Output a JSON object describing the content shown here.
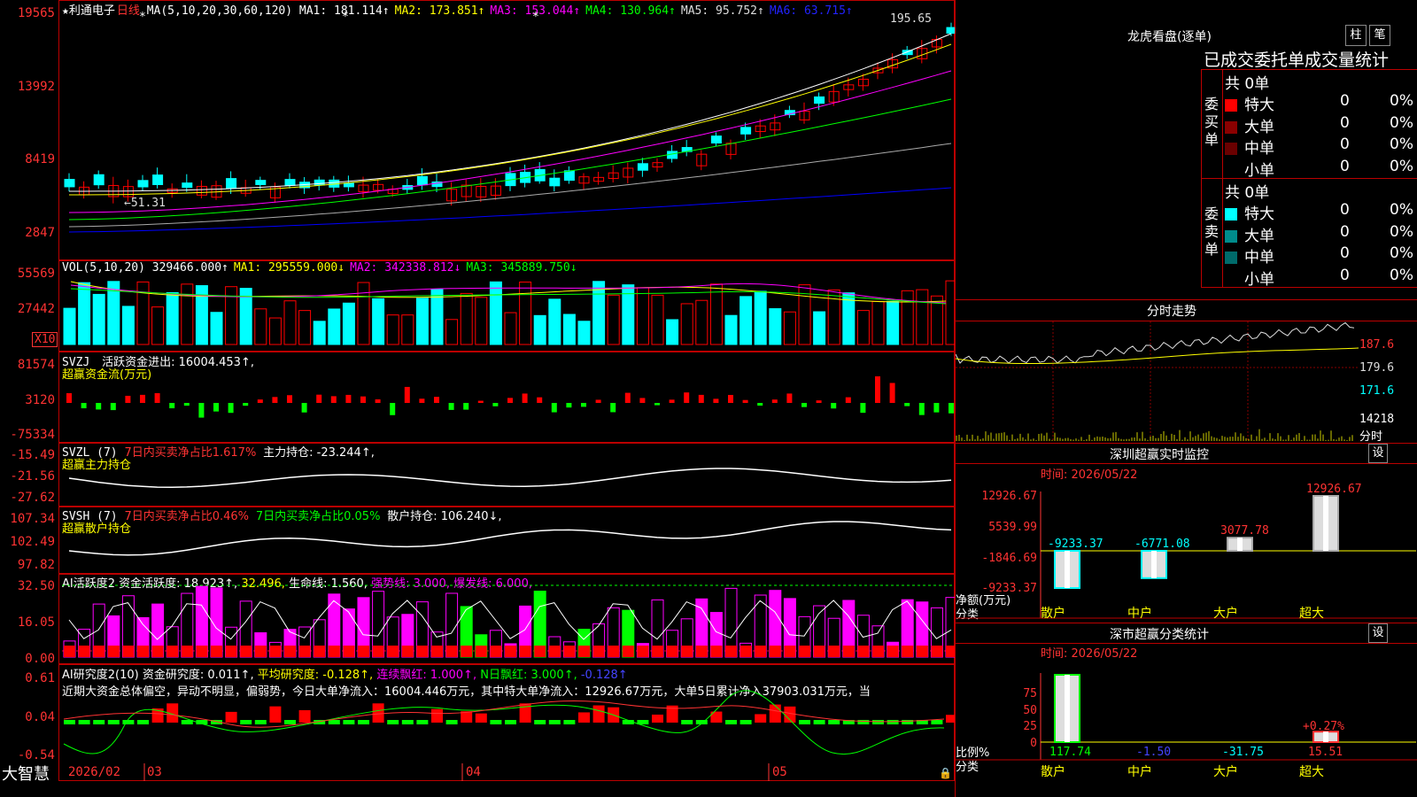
{
  "stock": {
    "star": "★",
    "name": "利通电子",
    "period": "日线",
    "ma_params": "MA(5,10,20,30,60,120)"
  },
  "main": {
    "ma_labels": [
      "MA1: 181.114↑",
      "MA2: 173.851↑",
      "MA3: 153.044↑",
      "MA4: 130.964↑",
      "MA5: 95.752↑",
      "MA6: 63.715↑"
    ],
    "y_ticks": [
      "19565",
      "13992",
      "8419",
      "2847"
    ],
    "high_label": "195.65",
    "low_label": "←51.31",
    "star_marks": [
      "*",
      "*",
      "*"
    ]
  },
  "vol": {
    "title": "VOL(5,10,20)",
    "value": "329466.000↑",
    "ma1": "MA1: 295559.000↓",
    "ma2": "MA2: 342338.812↓",
    "ma3": "MA3: 345889.750↓",
    "y_ticks": [
      "55569",
      "27442"
    ],
    "unit": "X10"
  },
  "svzj": {
    "title": "SVZJ",
    "label": "活跃资金进出: 16004.453↑,",
    "sub": "超赢资金流(万元)",
    "y_ticks": [
      "81574",
      "3120",
      "-75334"
    ]
  },
  "svzl": {
    "title": "SVZL (7)",
    "pct": "7日内买卖净占比1.617%",
    "label": "主力持仓: -23.244↑,",
    "sub": "超赢主力持仓",
    "y_ticks": [
      "-15.49",
      "-21.56",
      "-27.62"
    ]
  },
  "svsh": {
    "title": "SVSH (7)",
    "pct1": "7日内买卖净占比0.46%",
    "pct2": "7日内买卖净占比0.05%",
    "label": "散户持仓: 106.240↓,",
    "sub": "超赢散户持仓",
    "y_ticks": [
      "107.34",
      "102.49",
      "97.82"
    ]
  },
  "ai1": {
    "title": "AI活跃度2",
    "label": "资金活跃度: 18.923↑,",
    "v2": "32.496,",
    "life": "生命线: 1.560,",
    "strong": "强势线: 3.000,",
    "burst": "爆发线: 6.000,",
    "y_ticks": [
      "32.50",
      "16.05",
      "0.00"
    ]
  },
  "ai2": {
    "title": "AI研究度2(10)",
    "label": "资金研究度: 0.011↑,",
    "avg": "平均研究度: -0.128↑,",
    "red": "连续飘红: 1.000↑,",
    "nred": "N日飘红: 3.000↑,",
    "neg": "-0.128↑",
    "comment": "近期大资金总体偏空，异动不明显，偏弱势，今日大单净流入：16004.446万元，其中特大单净流入：12926.67万元，大单5日累计净入37903.031万元，当",
    "y_ticks": [
      "0.61",
      "0.04",
      "-0.54"
    ]
  },
  "bottom": {
    "brand": "大智慧",
    "dates": [
      "2026/02",
      "03",
      "04",
      "05"
    ]
  },
  "lhb": {
    "title": "龙虎看盘(逐单)",
    "btn1": "柱",
    "btn2": "笔",
    "header": "已成交委托单成交量统计",
    "buy_side": "委买单",
    "sell_side": "委卖单",
    "buy_total": "共 0单",
    "sell_total": "共 0单",
    "buy_rows": [
      {
        "label": "特大",
        "qty": "0",
        "pct": "0%",
        "color": "#ff0000"
      },
      {
        "label": "大单",
        "qty": "0",
        "pct": "0%",
        "color": "#8b0000"
      },
      {
        "label": "中单",
        "qty": "0",
        "pct": "0%",
        "color": "#6a0000"
      },
      {
        "label": "小单",
        "qty": "0",
        "pct": "0%",
        "color": "#000000"
      }
    ],
    "sell_rows": [
      {
        "label": "特大",
        "qty": "0",
        "pct": "0%",
        "color": "#00ffff"
      },
      {
        "label": "大单",
        "qty": "0",
        "pct": "0%",
        "color": "#008b8b"
      },
      {
        "label": "中单",
        "qty": "0",
        "pct": "0%",
        "color": "#006b6b"
      },
      {
        "label": "小单",
        "qty": "0",
        "pct": "0%",
        "color": "#000000"
      }
    ]
  },
  "intraday": {
    "title": "分时走势",
    "y_ticks": [
      "187.6",
      "179.6",
      "171.6",
      "14218"
    ],
    "unit": "分时"
  },
  "sz_monitor": {
    "title": "深圳超赢实时监控",
    "set_btn": "设",
    "time": "时间: 2026/05/22",
    "y_ticks": [
      "12926.67",
      "5539.99",
      "-1846.69",
      "-9233.37"
    ],
    "ylabel": "净额(万元)",
    "xlabel": "分类",
    "categories": [
      "散户",
      "中户",
      "大户",
      "超大"
    ],
    "values": [
      -9233.37,
      -6771.08,
      3077.78,
      12926.67
    ],
    "value_labels": [
      "-9233.37",
      "-6771.08",
      "3077.78",
      "12926.67"
    ]
  },
  "sz_stats": {
    "title": "深市超赢分类统计",
    "set_btn": "设",
    "time": "时间: 2026/05/22",
    "y_ticks": [
      "75",
      "50",
      "25",
      "0"
    ],
    "ylabel": "比例%",
    "xlabel": "分类",
    "categories": [
      "散户",
      "中户",
      "大户",
      "超大"
    ],
    "values": [
      117.74,
      -1.5,
      -31.75,
      15.51
    ],
    "value_labels": [
      "117.74",
      "-1.50",
      "-31.75",
      "15.51"
    ],
    "extra_label": "+0.27%"
  },
  "colors": {
    "up": "#ff0000",
    "down": "#00ffff",
    "border": "#b00000",
    "ma1": "#ffffff",
    "ma2": "#ffff00",
    "ma3": "#ff00ff",
    "ma4": "#00ff00",
    "ma5": "#aaaaaa",
    "ma6": "#0000ff"
  }
}
